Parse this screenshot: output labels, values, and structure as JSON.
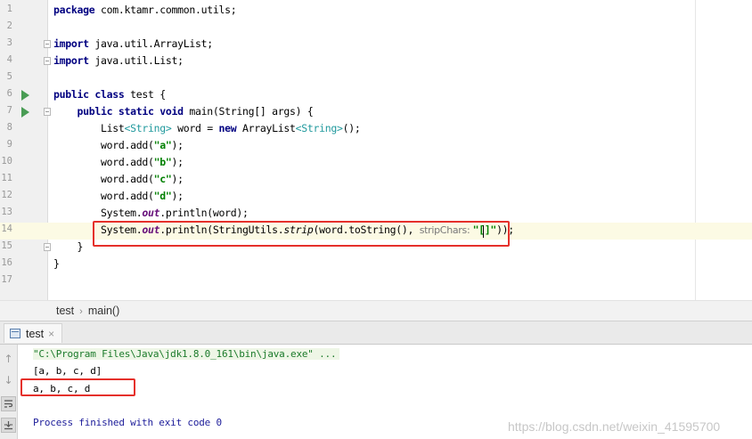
{
  "editor": {
    "lines": [
      {
        "n": "1",
        "segments": [
          {
            "t": "package",
            "c": "kw"
          },
          {
            "t": " com.ktamr.common.utils;",
            "c": ""
          }
        ]
      },
      {
        "n": "2",
        "segments": []
      },
      {
        "n": "3",
        "segments": [
          {
            "t": "import",
            "c": "kw"
          },
          {
            "t": " java.util.ArrayList;",
            "c": ""
          }
        ]
      },
      {
        "n": "4",
        "segments": [
          {
            "t": "import",
            "c": "kw"
          },
          {
            "t": " java.util.List;",
            "c": ""
          }
        ]
      },
      {
        "n": "5",
        "segments": []
      },
      {
        "n": "6",
        "segments": [
          {
            "t": "public class",
            "c": "kw"
          },
          {
            "t": " test {",
            "c": ""
          }
        ]
      },
      {
        "n": "7",
        "segments": [
          {
            "t": "    ",
            "c": ""
          },
          {
            "t": "public static void",
            "c": "kw"
          },
          {
            "t": " main(String[] args) {",
            "c": ""
          }
        ]
      },
      {
        "n": "8",
        "segments": [
          {
            "t": "        List",
            "c": ""
          },
          {
            "t": "<String>",
            "c": "gen"
          },
          {
            "t": " word = ",
            "c": ""
          },
          {
            "t": "new",
            "c": "kw"
          },
          {
            "t": " ArrayList",
            "c": ""
          },
          {
            "t": "<String>",
            "c": "gen"
          },
          {
            "t": "();",
            "c": ""
          }
        ]
      },
      {
        "n": "9",
        "segments": [
          {
            "t": "        word.add(",
            "c": ""
          },
          {
            "t": "\"a\"",
            "c": "str"
          },
          {
            "t": ");",
            "c": ""
          }
        ]
      },
      {
        "n": "10",
        "segments": [
          {
            "t": "        word.add(",
            "c": ""
          },
          {
            "t": "\"b\"",
            "c": "str"
          },
          {
            "t": ");",
            "c": ""
          }
        ]
      },
      {
        "n": "11",
        "segments": [
          {
            "t": "        word.add(",
            "c": ""
          },
          {
            "t": "\"c\"",
            "c": "str"
          },
          {
            "t": ");",
            "c": ""
          }
        ]
      },
      {
        "n": "12",
        "segments": [
          {
            "t": "        word.add(",
            "c": ""
          },
          {
            "t": "\"d\"",
            "c": "str"
          },
          {
            "t": ");",
            "c": ""
          }
        ]
      },
      {
        "n": "13",
        "segments": [
          {
            "t": "        System.",
            "c": ""
          },
          {
            "t": "out",
            "c": "static"
          },
          {
            "t": ".println(word);",
            "c": ""
          }
        ]
      },
      {
        "n": "14",
        "segments": [
          {
            "t": "        System.",
            "c": ""
          },
          {
            "t": "out",
            "c": "static"
          },
          {
            "t": ".println(StringUtils.",
            "c": ""
          },
          {
            "t": "strip",
            "c": "itl"
          },
          {
            "t": "(word.toString(), ",
            "c": ""
          },
          {
            "t": "stripChars: ",
            "c": "hint"
          },
          {
            "t": "\"[]\"",
            "c": "str"
          },
          {
            "t": "));",
            "c": ""
          }
        ]
      },
      {
        "n": "15",
        "segments": [
          {
            "t": "    }",
            "c": ""
          }
        ]
      },
      {
        "n": "16",
        "segments": [
          {
            "t": "}",
            "c": ""
          }
        ]
      },
      {
        "n": "17",
        "segments": []
      }
    ]
  },
  "breadcrumb": {
    "items": [
      "test",
      "main()"
    ],
    "separator": "›"
  },
  "run_panel": {
    "tab_label": "test",
    "tab_close": "×",
    "console": {
      "command": "\"C:\\Program Files\\Java\\jdk1.8.0_161\\bin\\java.exe\" ...",
      "output_line1": "[a, b, c, d]",
      "output_line2": "a, b, c, d",
      "exit_message": "Process finished with exit code 0"
    }
  },
  "watermark": "https://blog.csdn.net/weixin_41595700",
  "colors": {
    "highlight_box": "#e5302b",
    "keyword": "#000080",
    "string": "#008000",
    "run_icon": "#499c54"
  },
  "icons": {
    "run_gutter": "run-icon",
    "fold": "fold-icon",
    "toolbar": [
      "arrow-up-icon",
      "arrow-down-icon",
      "soft-wrap-icon",
      "scroll-to-end-icon"
    ]
  }
}
